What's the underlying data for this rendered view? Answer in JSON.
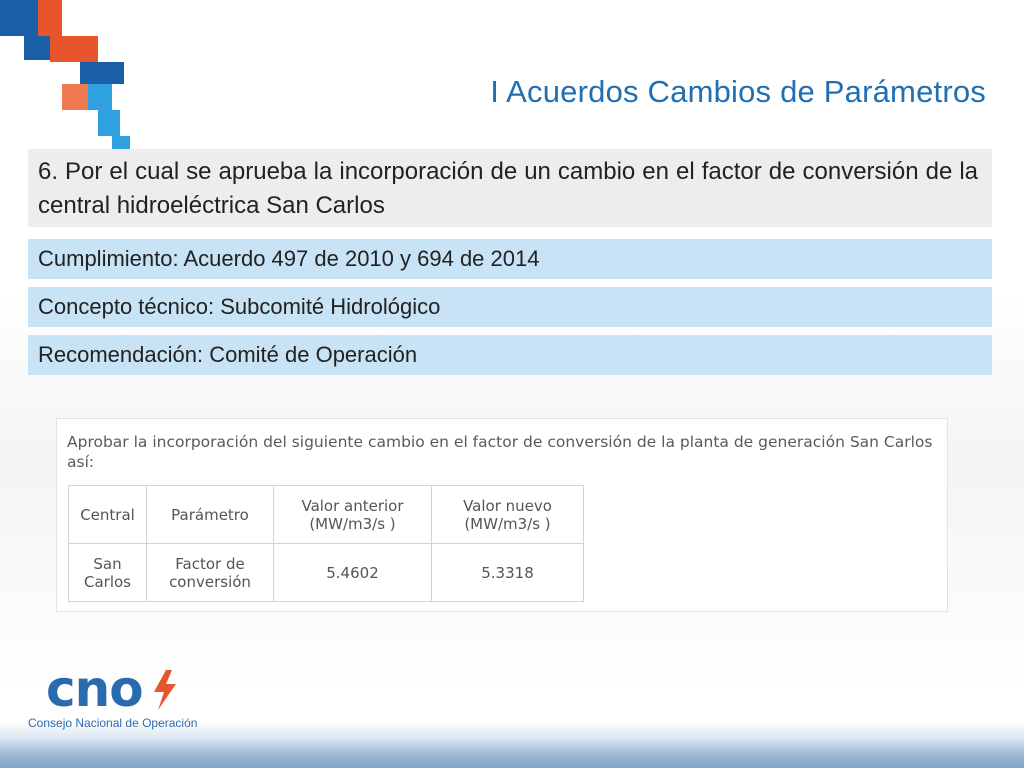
{
  "slide": {
    "title": "I Acuerdos Cambios de Parámetros",
    "item1": "6. Por el cual se aprueba la incorporación de un cambio en el factor de conversión de la central hidroeléctrica San Carlos",
    "bands": [
      "Cumplimiento: Acuerdo 497 de 2010 y 694 de 2014",
      "Concepto técnico: Subcomité Hidrológico",
      "Recomendación: Comité de Operación"
    ]
  },
  "excerpt": {
    "intro": "Aprobar la incorporación del siguiente cambio en el factor de conversión de la planta de generación San Carlos así:",
    "headers": [
      "Central",
      "Parámetro",
      "Valor anterior (MW/m3/s )",
      "Valor nuevo (MW/m3/s )"
    ],
    "row": [
      "San Carlos",
      "Factor de conversión",
      "5.4602",
      "5.3318"
    ]
  },
  "logo": {
    "word": "cno",
    "subtitle": "Consejo Nacional de Operación",
    "icon": "lightning-bolt-icon"
  },
  "colors": {
    "title_blue": "#1f6fb2",
    "band_blue": "#c9e3f6",
    "accent_orange": "#e8552c",
    "accent_blue": "#1a5fa8",
    "accent_cyan": "#2fa0e0"
  }
}
